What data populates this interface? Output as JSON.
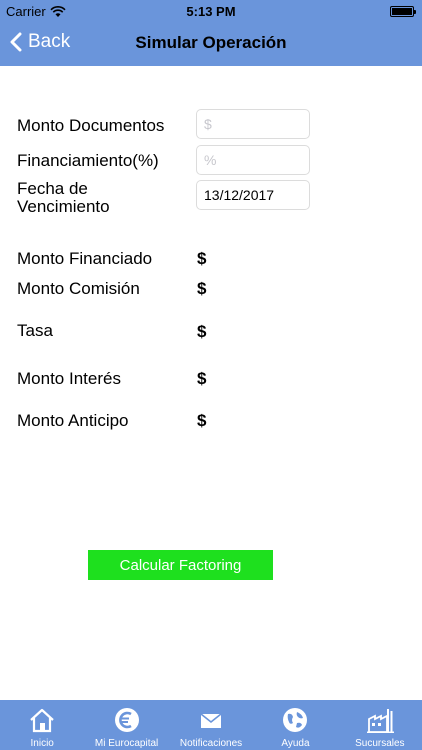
{
  "status_bar": {
    "carrier": "Carrier",
    "time": "5:13 PM"
  },
  "nav": {
    "back_label": "Back",
    "title": "Simular Operación"
  },
  "form": {
    "monto_documentos": {
      "label": "Monto Documentos",
      "value": "",
      "placeholder": "$"
    },
    "financiamiento": {
      "label": "Financiamiento(%)",
      "value": "",
      "placeholder": "%"
    },
    "fecha_vencimiento": {
      "label_line1": "Fecha de",
      "label_line2": "Vencimiento",
      "value": "13/12/2017"
    }
  },
  "results": [
    {
      "label": "Monto Financiado",
      "value": "$"
    },
    {
      "label": "Monto Comisión",
      "value": "$"
    },
    {
      "label": "Tasa",
      "value": "$"
    },
    {
      "label": "Monto Interés",
      "value": "$"
    },
    {
      "label": "Monto Anticipo",
      "value": "$"
    }
  ],
  "calc_button_label": "Calcular Factoring",
  "tabs": [
    {
      "label": "Inicio",
      "icon": "home-icon"
    },
    {
      "label": "Mi Eurocapital",
      "icon": "euro-clock-icon"
    },
    {
      "label": "Notificaciones",
      "icon": "envelope-icon"
    },
    {
      "label": "Ayuda",
      "icon": "globe-icon"
    },
    {
      "label": "Sucursales",
      "icon": "building-icon"
    }
  ],
  "colors": {
    "header_blue": "#6a95db",
    "button_green": "#1ee01e"
  }
}
